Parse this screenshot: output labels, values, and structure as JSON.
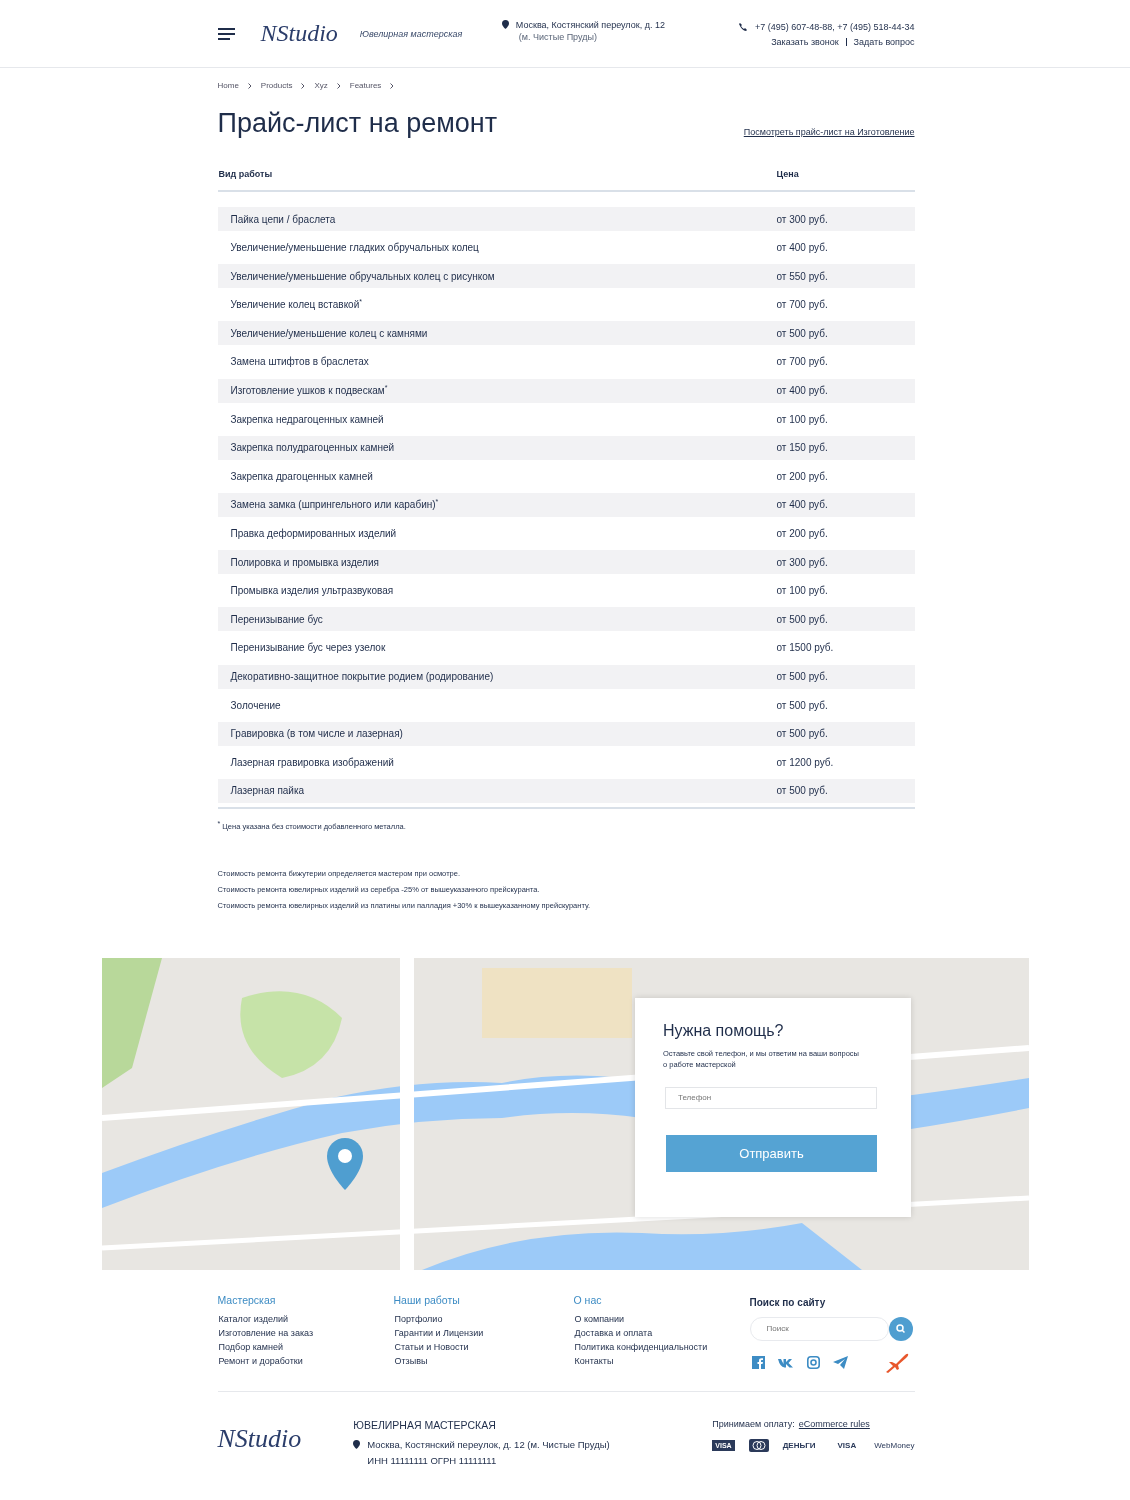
{
  "header": {
    "logo": "NStudio",
    "tagline": "Ювелирная мастерская",
    "address": "Москва, Костянский переулок, д. 12",
    "metro": "(м. Чистые Пруды)",
    "phones": "+7 (495) 607-48-88, +7 (495) 518-44-34",
    "links": [
      "Заказать звонок",
      "Задать вопрос"
    ]
  },
  "breadcrumbs": [
    "Home",
    "Products",
    "Xyz",
    "Features"
  ],
  "title": "Прайс-лист на ремонт",
  "title_link": "Посмотреть прайс-лист на Изготовление",
  "table": {
    "columns": [
      "Вид работы",
      "Цена"
    ],
    "rows": [
      {
        "work": "Пайка цепи / браслета",
        "price": "от 300 руб."
      },
      {
        "work": "Увеличение/уменьшение гладких обручальных колец",
        "price": "от 400 руб."
      },
      {
        "work": "Увеличение/уменьшение обручальных колец с рисунком",
        "price": "от 550 руб."
      },
      {
        "work": "Увеличение колец вставкой$^{*}$",
        "price": "от 700 руб."
      },
      {
        "work": "Увеличение/уменьшение колец с камнями",
        "price": "от 500 руб."
      },
      {
        "work": "Замена штифтов в браслетах",
        "price": "от 700 руб."
      },
      {
        "work": "Изготовление ушков к подвескам$^{*}$",
        "price": "от 400 руб."
      },
      {
        "work": "Закрепка недрагоценных камней",
        "price": "от 100 руб."
      },
      {
        "work": "Закрепка полудрагоценных камней",
        "price": "от 150 руб."
      },
      {
        "work": "Закрепка драгоценных камней",
        "price": "от 200 руб."
      },
      {
        "work": "Замена замка (шпрингельного или карабин)$^{*}$",
        "price": "от 400 руб."
      },
      {
        "work": "Правка деформированных изделий",
        "price": "от 200 руб."
      },
      {
        "work": "Полировка и промывка изделия",
        "price": "от 300 руб."
      },
      {
        "work": "Промывка изделия ультразвуковая",
        "price": "от 100 руб."
      },
      {
        "work": "Перенизывание бус",
        "price": "от 500 руб."
      },
      {
        "work": "Перенизывание бус через узелок",
        "price": "от 1500 руб."
      },
      {
        "work": "Декоративно-защитное покрытие родием (родирование)",
        "price": "от 500 руб."
      },
      {
        "work": "Золочение",
        "price": "от 500 руб."
      },
      {
        "work": "Гравировка (в том числе и лазерная)",
        "price": "от 500 руб."
      },
      {
        "work": "Лазерная гравировка изображений",
        "price": "от 1200 руб."
      },
      {
        "work": "Лазерная пайка",
        "price": "от 500 руб."
      }
    ]
  },
  "footnote": "$^{*}$ Цена указана без стоимости добавленного металла.",
  "notes": [
    "Стоимость ремонта бижутерии определяется мастером при осмотре.",
    "Стоимость ремонта ювелирных изделий из серебра -25% от вышеуказанного прейскуранта.",
    "Стоимость ремонта ювелирных изделий из платины или палладия +30% к вышеуказанному прейскуранту."
  ],
  "help_form": {
    "title": "Нужна помощь?",
    "text": "Оставьте свой телефон, и мы ответим на ваши вопросы о работе мастерской",
    "phone_placeholder": "Телефон",
    "submit": "Отправить"
  },
  "footer": {
    "columns": [
      {
        "title": "Мастерская",
        "links": [
          "Каталог изделий",
          "Изготовление на заказ",
          "Подбор камней",
          "Ремонт и доработки"
        ]
      },
      {
        "title": "Наши работы",
        "links": [
          "Портфолио",
          "Гарантии и Лицензии",
          "Статьи и Новости",
          "Отзывы"
        ]
      },
      {
        "title": "О нас",
        "links": [
          "О компании",
          "Доставка и оплата",
          "Политика конфиденциальности",
          "Контакты"
        ]
      }
    ],
    "search_title": "Поиск по сайту",
    "search_placeholder": "Поиск",
    "logo": "NStudio",
    "company": "ЮВЕЛИРНАЯ МАСТЕРСКАЯ",
    "address": "Москва, Костянский переулок, д. 12 (м. Чистые Пруды)",
    "legal": "ИНН 11111111 ОГРН 11111111",
    "payment_label": "Принимаем оплату:",
    "payment_link": "eCommerce rules",
    "payments": [
      {
        "kind": "visa",
        "label": "VISA"
      },
      {
        "kind": "mastercard"
      },
      {
        "kind": "yandex",
        "label": "ДЕНЬГИ"
      },
      {
        "kind": "qiwi",
        "label": "VISA"
      },
      {
        "kind": "webmoney",
        "label": "WebMoney"
      }
    ]
  }
}
